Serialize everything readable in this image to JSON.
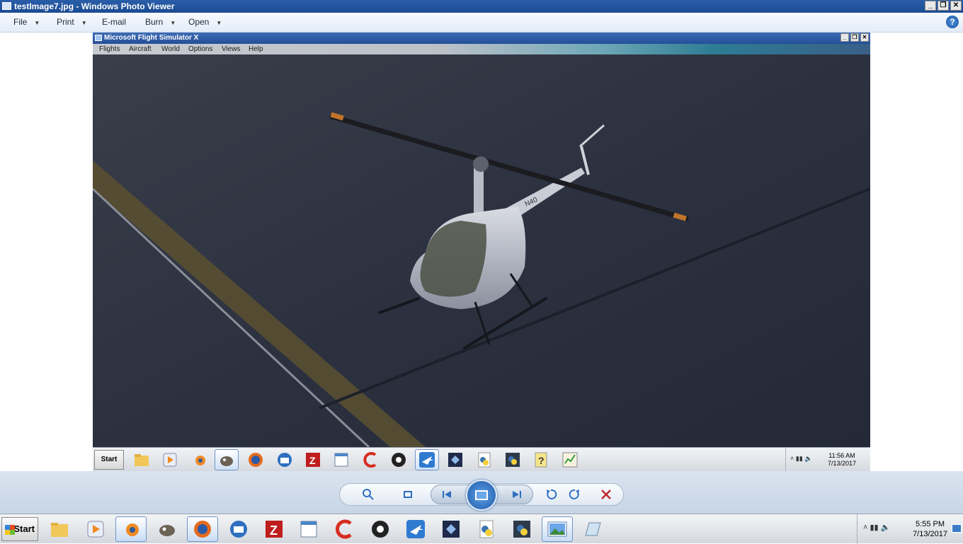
{
  "window": {
    "title": "testImage7.jpg - Windows Photo Viewer",
    "controls": [
      "_",
      "❐",
      "✕"
    ]
  },
  "menubar": {
    "items": [
      {
        "label": "File"
      },
      {
        "label": "Print"
      },
      {
        "label": "E-mail"
      },
      {
        "label": "Burn"
      },
      {
        "label": "Open"
      }
    ],
    "help_icon": "?"
  },
  "photo": {
    "fsx_title": "Microsoft Flight Simulator X",
    "fsx_menu": [
      "Flights",
      "Aircraft",
      "World",
      "Options",
      "Views",
      "Help"
    ],
    "inner_taskbar": {
      "start_label": "Start",
      "clock_time": "11:56 AM",
      "clock_date": "7/13/2017",
      "tray_arrow": "˄"
    },
    "helicopter_tail_number": "N40"
  },
  "viewer_controls": {
    "zoom_icon": "zoom-icon",
    "fit_icon": "fit-to-window-icon",
    "prev_icon": "previous-icon",
    "slideshow_icon": "slideshow-icon",
    "next_icon": "next-icon",
    "rotate_ccw_icon": "rotate-counterclockwise-icon",
    "rotate_cw_icon": "rotate-clockwise-icon",
    "delete_icon": "delete-icon"
  },
  "taskbar": {
    "start_label": "Start",
    "clock_time": "5:55 PM",
    "clock_date": "7/13/2017",
    "tray_arrow": "˄"
  },
  "colors": {
    "titlebar": "#1c4b92",
    "accent": "#2e6fc2",
    "delete": "#c0282c"
  }
}
